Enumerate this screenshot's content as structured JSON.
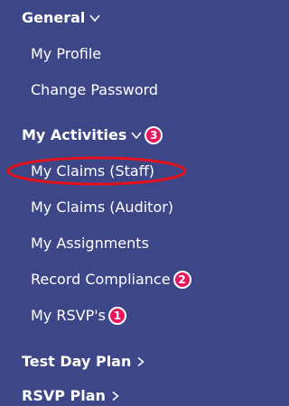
{
  "nav": {
    "general": {
      "label": "General"
    },
    "general_items": [
      {
        "label": "My Profile"
      },
      {
        "label": "Change Password"
      }
    ],
    "my_activities": {
      "label": "My Activities",
      "badge": "3"
    },
    "activity_items": [
      {
        "label": "My Claims (Staff)",
        "highlighted": true
      },
      {
        "label": "My Claims (Auditor)"
      },
      {
        "label": "My Assignments"
      },
      {
        "label": "Record Compliance",
        "badge": "2"
      },
      {
        "label": "My RSVP's",
        "badge": "1"
      }
    ],
    "test_day_plan": {
      "label": "Test Day Plan"
    },
    "rsvp_plan": {
      "label": "RSVP Plan"
    }
  },
  "colors": {
    "background": "#3d4687",
    "text": "#ffffff",
    "badge": "#e8175d",
    "annotation": "#e3111c"
  }
}
